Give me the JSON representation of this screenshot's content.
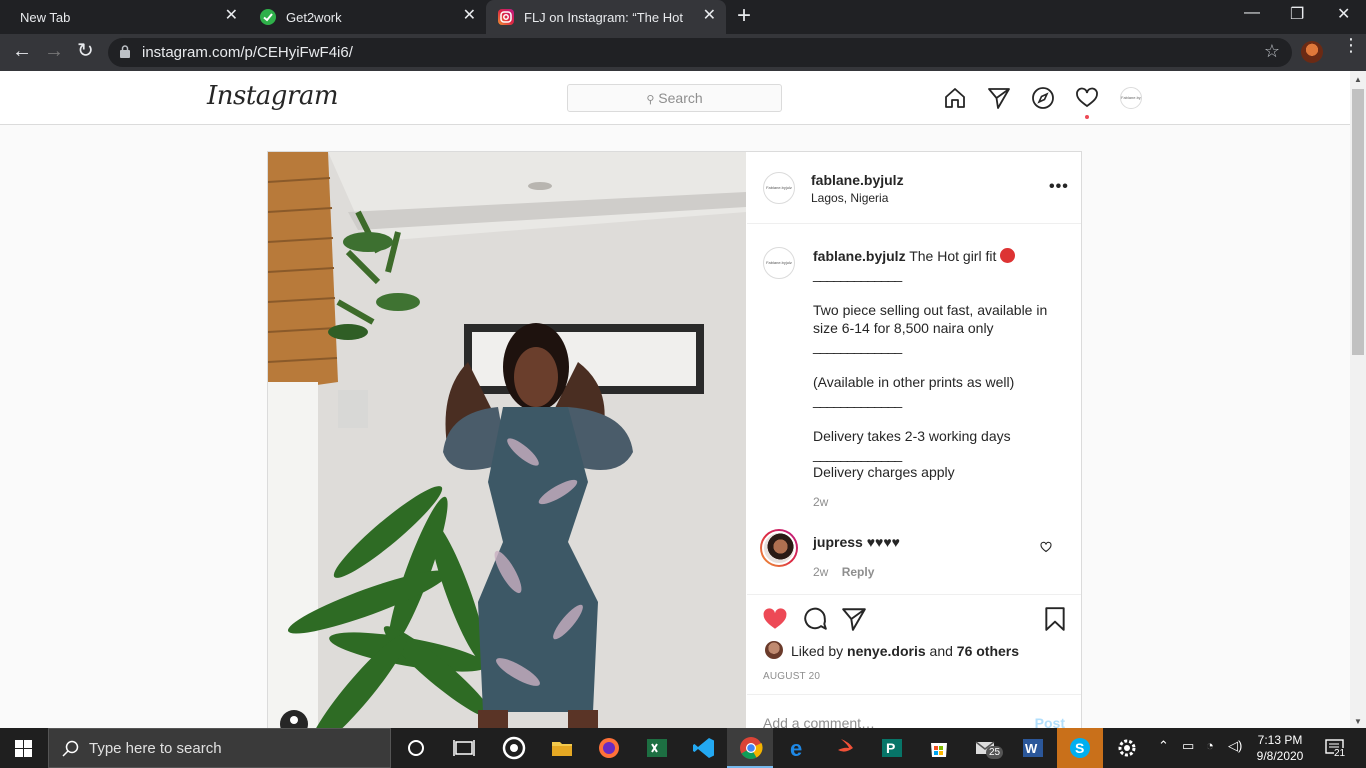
{
  "browser": {
    "tabs": [
      {
        "title": "New Tab"
      },
      {
        "title": "Get2work"
      },
      {
        "title": "FLJ on Instagram: “The Hot girl fit"
      }
    ],
    "url": "instagram.com/p/CEHyiFwF4i6/"
  },
  "instagram": {
    "logo": "Instagram",
    "search_placeholder": "Search",
    "post": {
      "username": "fablane.byjulz",
      "location": "Lagos, Nigeria",
      "caption_user": "fablane.byjulz",
      "caption_lines": [
        "The Hot girl fit",
        "_____________",
        "Two piece selling out fast, available in size 6-14 for 8,500 naira only",
        "_____________",
        "(Available in other prints as well)",
        "_____________",
        "Delivery takes 2-3 working days",
        "_____________",
        "Delivery charges apply"
      ],
      "caption_age": "2w",
      "comment": {
        "user": "jupress",
        "text": "♥♥♥♥",
        "age": "2w",
        "reply_label": "Reply"
      },
      "likes_prefix": "Liked by",
      "liked_by_user": "nenye.doris",
      "likes_and": "and",
      "likes_others": "76 others",
      "date": "AUGUST 20",
      "add_comment_placeholder": "Add a comment…",
      "post_button": "Post"
    },
    "avatar_text": "Fablane.byjulz"
  },
  "taskbar": {
    "search_placeholder": "Type here to search",
    "badge_mail": "25",
    "time": "7:13 PM",
    "date": "9/8/2020",
    "notif_count": "21"
  },
  "colors": {
    "heart_red": "#ed4956",
    "chrome_dark": "#202124",
    "chrome_toolbar": "#35363a",
    "ig_border": "#dbdbdb"
  }
}
